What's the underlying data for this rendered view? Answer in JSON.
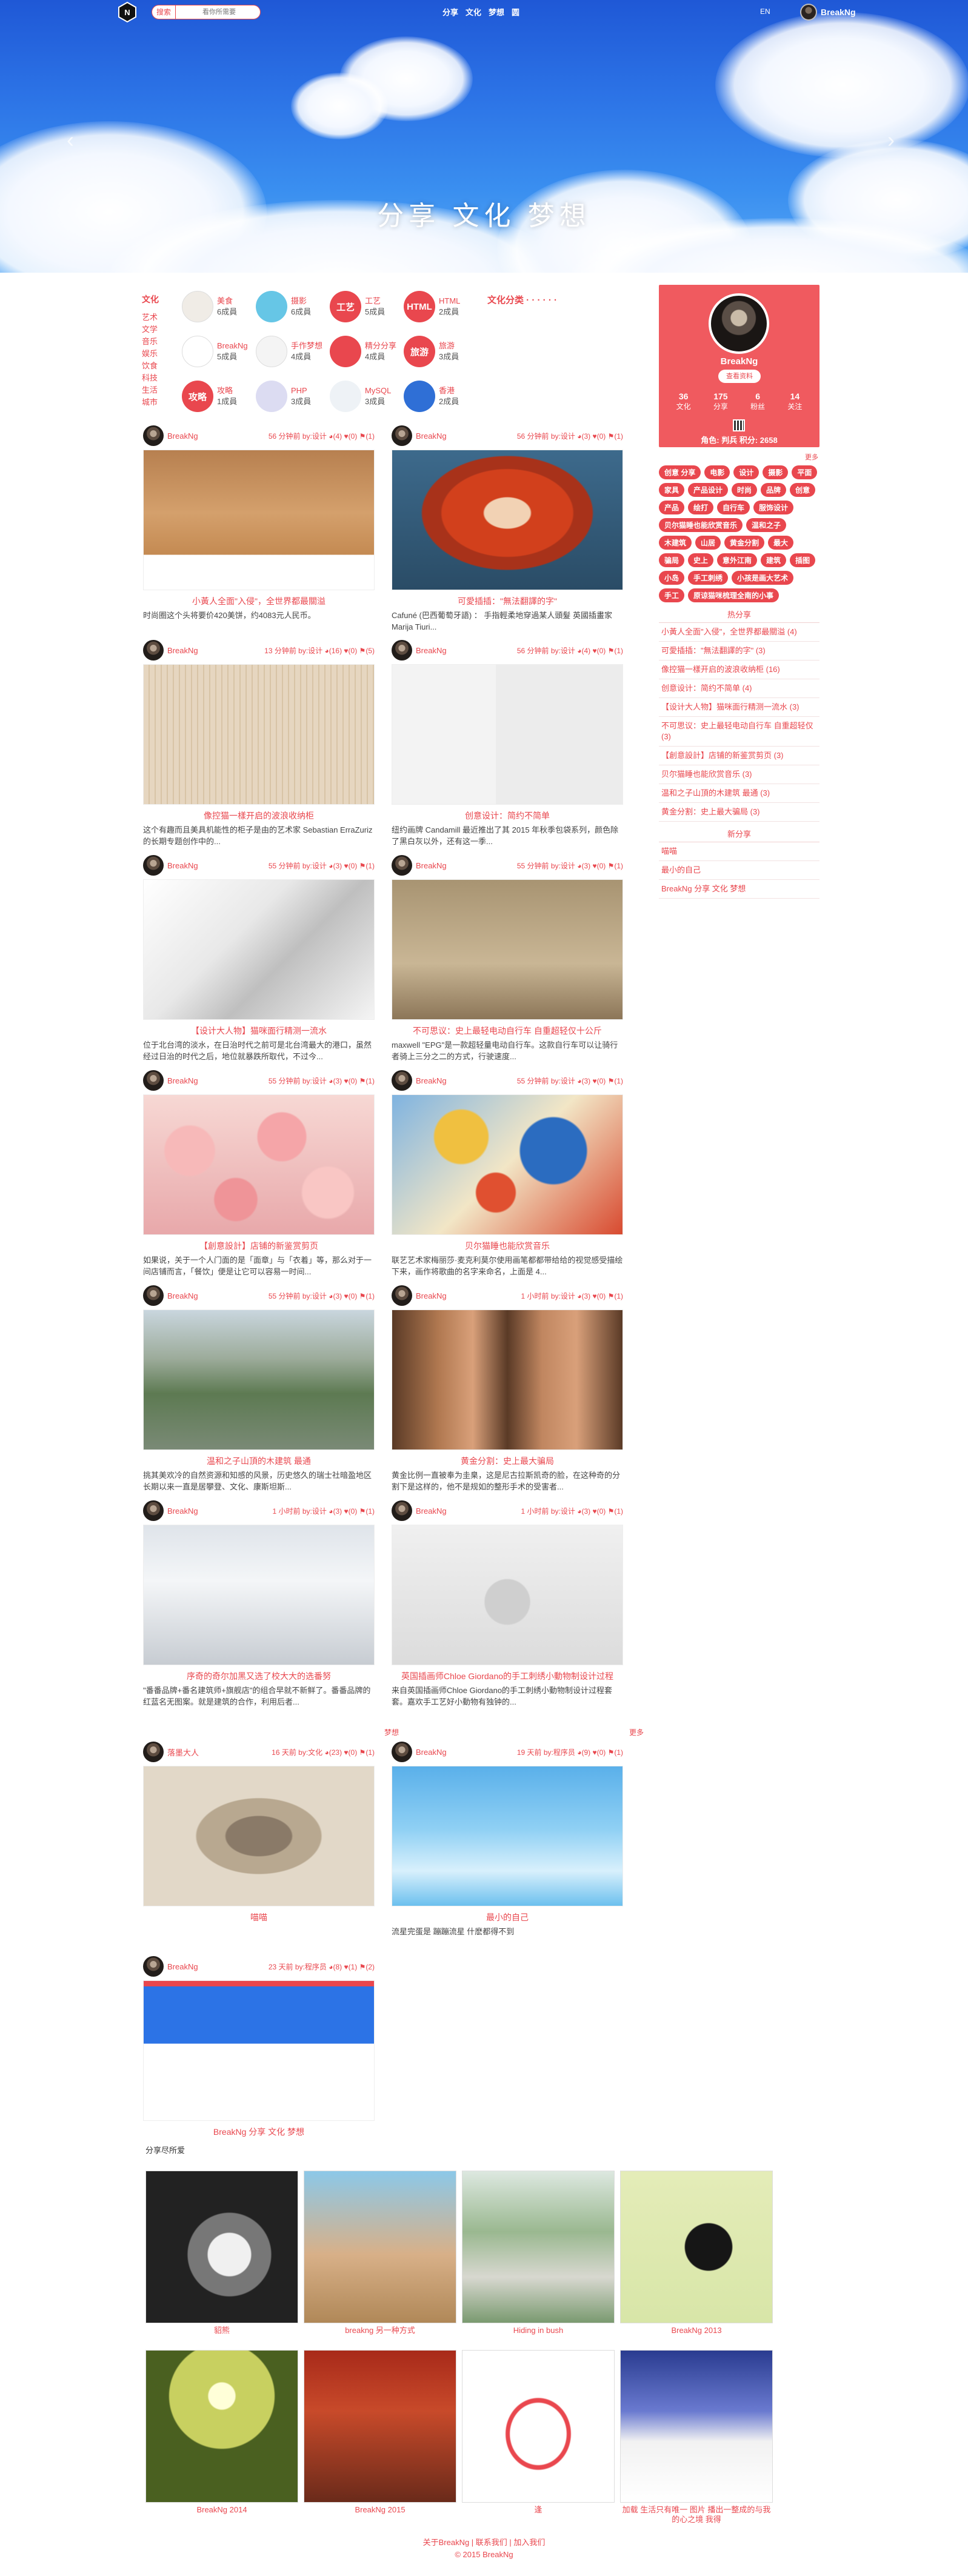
{
  "search": {
    "button": "搜索",
    "placeholder": "看你所需要"
  },
  "nav": {
    "items": [
      "分享",
      "文化",
      "梦想",
      "圆"
    ],
    "lang": "EN",
    "username": "BreakNg"
  },
  "hero": {
    "title": "分享  文化  梦想"
  },
  "categories": {
    "left_title": "文化",
    "left_list": [
      "艺术",
      "文学",
      "音乐",
      "娱乐",
      "饮食",
      "科技",
      "生活",
      "城市"
    ],
    "class_title": "文化分类 · · · · · ·",
    "items": [
      {
        "name": "美食",
        "count": "6成員",
        "icon": "food-icon",
        "color": "#f0ece6"
      },
      {
        "name": "摄影",
        "count": "6成員",
        "icon": "camera-icon",
        "color": "#66c6e6"
      },
      {
        "name": "工艺",
        "count": "5成員",
        "icon": "craft-icon",
        "label": "工艺",
        "color": "#e9474e"
      },
      {
        "name": "HTML",
        "count": "2成員",
        "icon": "html-icon",
        "label": "HTML",
        "color": "#e9474e"
      },
      {
        "name": "BreakNg",
        "count": "5成員",
        "icon": "breakng-icon",
        "color": "#ffffff"
      },
      {
        "name": "手作梦想",
        "count": "4成員",
        "icon": "handcraft-icon",
        "color": "#f4f4f4"
      },
      {
        "name": "精分分享",
        "count": "4成員",
        "icon": "share-icon",
        "color": "#e9474e"
      },
      {
        "name": "旅游",
        "count": "3成員",
        "icon": "travel-icon",
        "label": "旅游",
        "color": "#e9474e"
      },
      {
        "name": "攻略",
        "count": "1成員",
        "icon": "guide-icon",
        "label": "攻略",
        "color": "#e9474e"
      },
      {
        "name": "PHP",
        "count": "3成員",
        "icon": "php-icon",
        "color": "#dcdcf2"
      },
      {
        "name": "MySQL",
        "count": "3成員",
        "icon": "mysql-icon",
        "color": "#eef2f6"
      },
      {
        "name": "香港",
        "count": "2成員",
        "icon": "hongkong-icon",
        "color": "#2f6fd6"
      }
    ]
  },
  "profile": {
    "name": "BreakNg",
    "button": "查看资料",
    "stats": [
      {
        "num": "36",
        "label": "文化"
      },
      {
        "num": "175",
        "label": "分享"
      },
      {
        "num": "6",
        "label": "粉丝"
      },
      {
        "num": "14",
        "label": "关注"
      }
    ],
    "role": "角色: 判兵    积分: 2658"
  },
  "sidebar": {
    "more": "更多",
    "tags": [
      "创意 分享",
      "电影",
      "设计",
      "摄影",
      "平面",
      "家具",
      "产品设计",
      "时尚",
      "品牌",
      "创意",
      "产品",
      "绘打",
      "自行车",
      "服饰设计",
      "贝尔猫睡也能欣赏音乐",
      "温和之子",
      "木建筑",
      "山居",
      "黄金分割",
      "最大",
      "骗局",
      "史上",
      "意外江南",
      "建筑",
      "插图",
      "小岛",
      "手工刺绣",
      "小孩是画大艺术",
      "手工",
      "原谅猫咪梳理全南的小事"
    ],
    "hot_title": "热分享",
    "hot_list": [
      "小黃人全面\"入侵\"，全世界都最關溢 (4)",
      "可愛插插：\"無法翻譯的字\" (3)",
      "像控猫一樣开启的波浪收纳柜 (16)",
      "创意设计：简约不简单 (4)",
      "【设计大人物】猫咪面行精测一流水 (3)",
      "不可思议：史上最轻电动自行车 自重超轻仅 (3)",
      "【創意設計】店铺的新鉴赏剪页 (3)",
      "贝尔猫睡也能欣赏音乐 (3)",
      "温和之子山頂的木建筑 最通 (3)",
      "黄金分割：史上最大骗局 (3)"
    ],
    "new_title": "新分享",
    "new_list": [
      "喵喵",
      "最小的自己",
      "BreakNg 分享 文化 梦想"
    ]
  },
  "posts": [
    {
      "author": "BreakNg",
      "meta": "56 分钟前 by:设计 ◕(4) ♥(0) ⚑(1)",
      "title": "小黃人全面\"入侵\"，全世界都最關溢",
      "excerpt": "时尚圈这个头将要价420美饼，约4083元人民币。",
      "img": "minion"
    },
    {
      "author": "BreakNg",
      "meta": "56 分钟前 by:设计 ◕(3) ♥(0) ⚑(1)",
      "title": "可愛插插：\"無法翻譯的字\"",
      "excerpt": "Cafuné (巴西葡萄牙語) ： 手指輕柔地穿過某人頭髮    英國插畫家 Marija Tiuri...",
      "img": "merida"
    },
    {
      "author": "BreakNg",
      "meta": "13 分钟前 by:设计 ◕(16) ♥(0) ⚑(5)",
      "title": "像控猫一樣开启的波浪收纳柜",
      "excerpt": "这个有趣而且美具机能性的柜子是由的艺术家 Sebastian ErraZuriz 的长期专题创作中的...",
      "img": "cabinet"
    },
    {
      "author": "BreakNg",
      "meta": "56 分钟前 by:设计 ◕(4) ♥(0) ⚑(1)",
      "title": "创意设计：简约不简单",
      "excerpt": "纽约画牌 Candamill 最近推出了其 2015 年秋季包袋系列，颜色除了黑白灰以外，还有这一季...",
      "img": "bag"
    },
    {
      "author": "BreakNg",
      "meta": "55 分钟前 by:设计 ◕(3) ♥(0) ⚑(1)",
      "title": "【设计大人物】猫咪面行精测一流水",
      "excerpt": "位于北台湾的淡水，在日治时代之前可是北台湾最大的港口，虽然经过日治的时代之后，地位就暴跌所取代，不过今...",
      "img": "tamsui"
    },
    {
      "author": "BreakNg",
      "meta": "55 分钟前 by:设计 ◕(3) ♥(0) ⚑(1)",
      "title": "不可思议：史上最轻电动自行车 自重超轻仅十公斤",
      "excerpt": "maxwell \"EPG\"是一款超轻量电动自行车。这款自行车可以让骑行者骑上三分之二的方式，行驶速度...",
      "img": "bike"
    },
    {
      "author": "BreakNg",
      "meta": "55 分钟前 by:设计 ◕(3) ♥(0) ⚑(1)",
      "title": "【創意設計】店铺的新鉴赏剪页",
      "excerpt": "如果说，关于一个人门面的是「面章」与「衣着」等，那么对于一间店铺而言，「餐饮」便是让它可以容易一时间...",
      "img": "umbrellas"
    },
    {
      "author": "BreakNg",
      "meta": "55 分钟前 by:设计 ◕(3) ♥(0) ⚑(1)",
      "title": "贝尔猫睡也能欣赏音乐",
      "excerpt": "联艺艺术家梅丽莎·麦克利莫尔使用画笔都都带给给的视觉感受描绘下来，画作将歌曲的名字来命名，上面是 4...",
      "img": "paint"
    },
    {
      "author": "BreakNg",
      "meta": "55 分钟前 by:设计 ◕(3) ♥(0) ⚑(1)",
      "title": "温和之子山頂的木建筑 最通",
      "excerpt": "挑其美欢冷的自然资源和知感的风景，历史悠久的瑞士社暗盈地区长期以来一直是居攀登、文化、康斯坦斯...",
      "img": "mountain"
    },
    {
      "author": "BreakNg",
      "meta": "1 小时前 by:设计 ◕(3) ♥(0) ⚑(1)",
      "title": "黄金分割：史上最大骗局",
      "excerpt": "黄金比例一直被奉为圭臬，这是尼古拉斯凯奇的脸，在这种奇的分割下是这样的，他不是规如的整形手术的受害者...",
      "img": "cage"
    },
    {
      "author": "BreakNg",
      "meta": "1 小时前 by:设计 ◕(3) ♥(0) ⚑(1)",
      "title": "序奇的奇尔加黑又选了校大大的选番努",
      "excerpt": "\"番番品牌+番名建筑师+旗舰店\"的组合早就不新鲜了。番番品牌的红蓝名无图案。就是建筑的合作，利用后者...",
      "img": "architecture"
    },
    {
      "author": "BreakNg",
      "meta": "1 小时前 by:设计 ◕(3) ♥(0) ⚑(1)",
      "title": "英国插画师Chloe Giordano的手工刺绣小動物制设计过程",
      "excerpt": "来自英国插画师Chloe Giordano的手工刺绣小動物制设计过程套套。嘉欢手工艺好小動物有独钟的...",
      "img": "embroidery"
    }
  ],
  "section2": {
    "title": "梦想",
    "more": "更多"
  },
  "posts2": [
    {
      "author": "落墨大人",
      "meta": "16 天前 by:文化 ◕(23) ♥(0) ⚑(1)",
      "title": "喵喵",
      "excerpt": "",
      "img": "catsketch"
    },
    {
      "author": "BreakNg",
      "meta": "19 天前 by:程序员 ◕(9) ♥(0) ⚑(1)",
      "title": "最小的自己",
      "excerpt": "流星完蛋是 蹦蹦流星 什麽都得不到",
      "img": "sky"
    },
    {
      "author": "BreakNg",
      "meta": "23 天前 by:程序员 ◕(8) ♥(1) ⚑(2)",
      "title": "BreakNg 分享 文化 梦想",
      "excerpt": "",
      "img": "screenshot"
    }
  ],
  "gallery": {
    "title": "分享尽所爱",
    "items": [
      {
        "caption": "貂熊",
        "img": "bw-cat"
      },
      {
        "caption": "breakng 另一种方式",
        "img": "dance"
      },
      {
        "caption": "Hiding in bush",
        "img": "road"
      },
      {
        "caption": "BreakNg 2013",
        "img": "smiley"
      },
      {
        "caption": "BreakNg 2014",
        "img": "tree"
      },
      {
        "caption": "BreakNg 2015",
        "img": "market"
      },
      {
        "caption": "逢",
        "img": "doodle"
      },
      {
        "caption": "加载 \n 生活只有唯一 图片 \n 播出一整成的与我的心之境 \n 我得",
        "img": "street"
      }
    ]
  },
  "footer": {
    "line1": "关于BreakNg | 联系我们 | 加入我们",
    "line2": "© 2015 BreakNg"
  }
}
